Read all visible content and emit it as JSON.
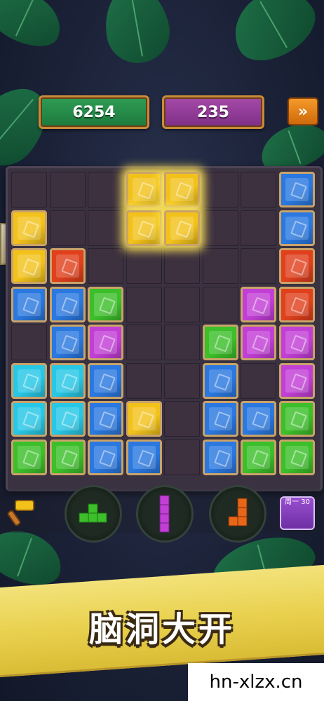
{
  "hud": {
    "score": "6254",
    "best_score": "235",
    "next_label": "»"
  },
  "board": {
    "columns": 8,
    "rows": 8,
    "gems": [
      {
        "col": 7,
        "row": 0,
        "color": "blue"
      },
      {
        "col": 0,
        "row": 1,
        "color": "yellow"
      },
      {
        "col": 7,
        "row": 1,
        "color": "blue"
      },
      {
        "col": 0,
        "row": 2,
        "color": "yellow"
      },
      {
        "col": 1,
        "row": 2,
        "color": "red"
      },
      {
        "col": 7,
        "row": 2,
        "color": "red"
      },
      {
        "col": 0,
        "row": 3,
        "color": "blue"
      },
      {
        "col": 1,
        "row": 3,
        "color": "blue"
      },
      {
        "col": 2,
        "row": 3,
        "color": "green"
      },
      {
        "col": 6,
        "row": 3,
        "color": "purple"
      },
      {
        "col": 7,
        "row": 3,
        "color": "red"
      },
      {
        "col": 1,
        "row": 4,
        "color": "blue"
      },
      {
        "col": 2,
        "row": 4,
        "color": "purple"
      },
      {
        "col": 5,
        "row": 4,
        "color": "green"
      },
      {
        "col": 6,
        "row": 4,
        "color": "purple"
      },
      {
        "col": 7,
        "row": 4,
        "color": "purple"
      },
      {
        "col": 0,
        "row": 5,
        "color": "cyan"
      },
      {
        "col": 1,
        "row": 5,
        "color": "cyan"
      },
      {
        "col": 2,
        "row": 5,
        "color": "blue"
      },
      {
        "col": 5,
        "row": 5,
        "color": "blue"
      },
      {
        "col": 7,
        "row": 5,
        "color": "purple"
      },
      {
        "col": 0,
        "row": 6,
        "color": "cyan"
      },
      {
        "col": 1,
        "row": 6,
        "color": "cyan"
      },
      {
        "col": 2,
        "row": 6,
        "color": "blue"
      },
      {
        "col": 3,
        "row": 6,
        "color": "yellow"
      },
      {
        "col": 5,
        "row": 6,
        "color": "blue"
      },
      {
        "col": 6,
        "row": 6,
        "color": "blue"
      },
      {
        "col": 7,
        "row": 6,
        "color": "green"
      },
      {
        "col": 0,
        "row": 7,
        "color": "green"
      },
      {
        "col": 1,
        "row": 7,
        "color": "green"
      },
      {
        "col": 2,
        "row": 7,
        "color": "blue"
      },
      {
        "col": 3,
        "row": 7,
        "color": "blue"
      },
      {
        "col": 5,
        "row": 7,
        "color": "blue"
      },
      {
        "col": 6,
        "row": 7,
        "color": "green"
      },
      {
        "col": 7,
        "row": 7,
        "color": "green"
      }
    ],
    "active_piece": {
      "color": "yellow",
      "cells": [
        [
          3,
          0
        ],
        [
          4,
          0
        ],
        [
          3,
          1
        ],
        [
          4,
          1
        ]
      ]
    }
  },
  "pieces_tray": [
    {
      "name": "t-shape",
      "color": "green"
    },
    {
      "name": "i-vertical",
      "color": "purple"
    },
    {
      "name": "j-shape",
      "color": "orange"
    }
  ],
  "tools": {
    "hammer_icon": "hammer-icon",
    "mode_label": "周一 30"
  },
  "colors": {
    "yellow": "#f2c21b",
    "blue": "#2a78e0",
    "red": "#e0401c",
    "green": "#3cbf2a",
    "purple": "#c23fd6",
    "cyan": "#27c7e6",
    "orange": "#e8661a"
  },
  "banner": {
    "slogan": "脑洞大开"
  },
  "watermark": "hn-xlzx.cn"
}
